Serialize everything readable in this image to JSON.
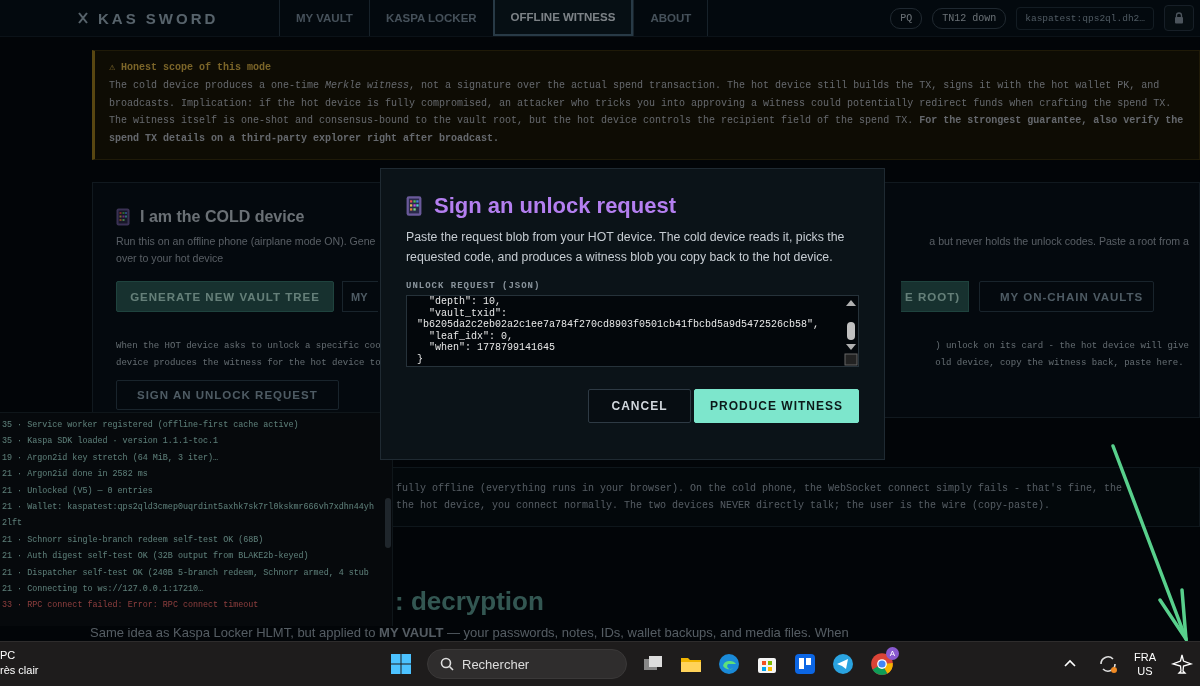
{
  "header": {
    "logo": "KAS SWORD",
    "tabs": [
      {
        "label": "MY VAULT",
        "selected": false
      },
      {
        "label": "KASPA LOCKER",
        "selected": false
      },
      {
        "label": "OFFLINE WITNESS",
        "selected": true
      },
      {
        "label": "ABOUT",
        "selected": false
      }
    ],
    "pq_badge": "PQ",
    "network_badge": "TN12 down",
    "address": "kaspatest:qps2ql.dh2…"
  },
  "warning": {
    "title": "⚠ Honest scope of this mode",
    "body": "The cold device produces a one-time *Merkle witness*, not a signature over the actual spend transaction. The hot device still builds the TX, signs it with the hot wallet PK, and broadcasts. Implication: if the hot device is fully compromised, an attacker who tricks you into approving a witness could potentially redirect funds when crafting the spend TX. The witness itself is one-shot and consensus-bound to the vault root, but the hot device controls the recipient field of the spend TX. **For the strongest guarantee, also verify the spend TX details on a third-party explorer right after broadcast.**"
  },
  "cold_card": {
    "title": "I am the COLD device",
    "description_left": "Run this on an offline phone (airplane mode ON). Gene",
    "description_right": "a but never holds the unlock codes. Paste a root from a",
    "description_line_2": "over to your hot device",
    "buttons": [
      {
        "label": "GENERATE NEW VAULT TREE",
        "kind": "primary"
      },
      {
        "label": "MY",
        "kind": "outline"
      },
      {
        "label": "E ROOT)",
        "kind": "primary"
      },
      {
        "label": "MY ON-CHAIN VAULTS",
        "kind": "outline"
      }
    ],
    "when_left": [
      "When the HOT device asks to unlock a specific coo",
      "device produces the witness for the hot device to"
    ],
    "when_right": [
      ") unlock on its card - the hot device will give",
      "old device, copy the witness back, paste here."
    ],
    "sign_button": "SIGN AN UNLOCK REQUEST"
  },
  "info_box": {
    "lines": [
      "fully offline (everything runs in your browser). On the cold phone, the WebSocket connect simply fails - that's fine, the",
      "the hot device, you connect normally. The two devices NEVER directly talk; the user is the wire (copy-paste)."
    ]
  },
  "section": {
    "heading": ": decryption",
    "paragraph": "Same idea as Kaspa Locker HLMT, but applied to **MY VAULT** — your passwords, notes, IDs, wallet backups, and media files. When"
  },
  "log": [
    {
      "text": "35 · Service worker registered (offline-first cache active)",
      "kind": "info"
    },
    {
      "text": "35 · Kaspa SDK loaded · version 1.1.1-toc.1",
      "kind": "info"
    },
    {
      "text": "19 · Argon2id key stretch (64 MiB, 3 iter)…",
      "kind": "info"
    },
    {
      "text": "21 · Argon2id done in 2582 ms",
      "kind": "info"
    },
    {
      "text": "21 · Unlocked (V5) — 0 entries",
      "kind": "info"
    },
    {
      "text": "21 · Wallet: kaspatest:qps2qld3cmep0uqrdint5axhk7sk7rl0kskmr666vh7xdhn44yh 2lft",
      "kind": "info"
    },
    {
      "text": "21 · Schnorr single-branch redeem self-test OK (68B)",
      "kind": "info"
    },
    {
      "text": "21 · Auth digest self-test OK (32B output from BLAKE2b-keyed)",
      "kind": "info"
    },
    {
      "text": "21 · Dispatcher self-test OK (240B 5-branch redeem, Schnorr armed, 4 stub",
      "kind": "info"
    },
    {
      "text": "21 · Connecting to ws://127.0.0.1:17210…",
      "kind": "info"
    },
    {
      "text": "33 · RPC connect failed: Error: RPC connect timeout",
      "kind": "error"
    }
  ],
  "modal": {
    "title": "Sign an unlock request",
    "description": "Paste the request blob from your HOT device. The cold device reads it, picks the requested code, and produces a witness blob you copy back to the hot device.",
    "field_label": "UNLOCK REQUEST (JSON)",
    "field_value": "  \"depth\": 10,\n  \"vault_txid\":\n\"b6205da2c2eb02a2c1ee7a784f270cd8903f0501cb41fbcbd5a9d5472526cb58\",\n  \"leaf_idx\": 0,\n  \"when\": 1778799141645\n}",
    "buttons": [
      {
        "label": "CANCEL",
        "kind": "outline"
      },
      {
        "label": "PRODUCE WITNESS",
        "kind": "primary"
      }
    ]
  },
  "taskbar": {
    "weather_temp": "PC",
    "weather_text": "rès clair",
    "search_placeholder": "Rechercher",
    "chrome_badge": "A",
    "language": "FRA",
    "layout": "US"
  }
}
